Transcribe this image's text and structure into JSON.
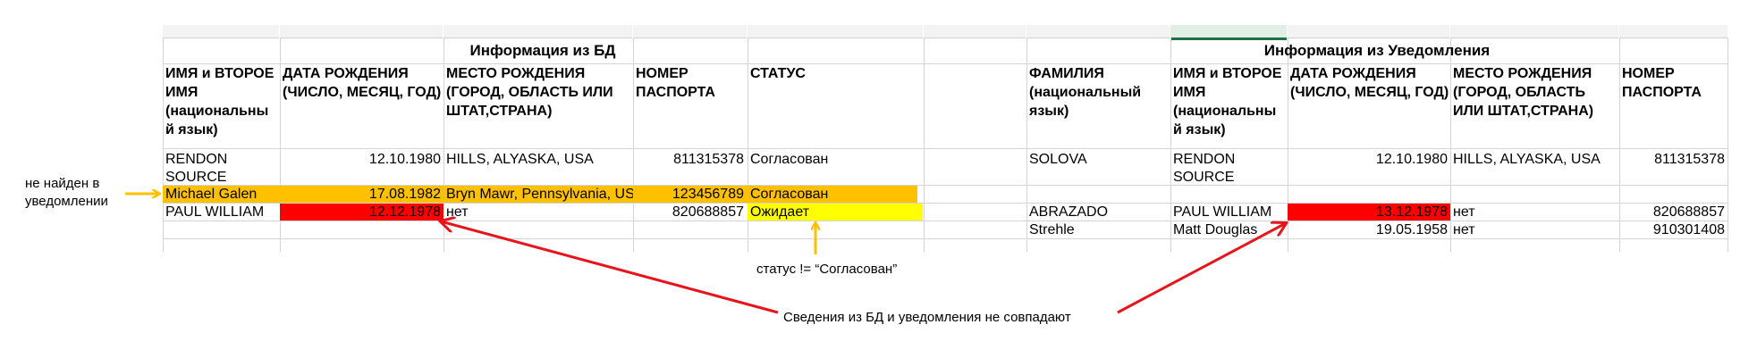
{
  "left_table": {
    "title": "Информация из БД",
    "headers": {
      "name": "ИМЯ и ВТОРОЕ ИМЯ (национальны й язык)",
      "dob": "ДАТА РОЖДЕНИЯ (ЧИСЛО, МЕСЯЦ, ГОД)",
      "pob": "МЕСТО РОЖДЕНИЯ (ГОРОД, ОБЛАСТЬ ИЛИ ШТАТ,СТРАНА)",
      "passport": "НОМЕР ПАСПОРТА",
      "status": "СТАТУС"
    },
    "rows": [
      {
        "name": "RENDON SOURCE",
        "dob": "12.10.1980",
        "pob": "HILLS, ALYASKA, USA",
        "passport": "811315378",
        "status": "Согласован"
      },
      {
        "name": "Michael Galen",
        "dob": "17.08.1982",
        "pob": "Bryn Mawr, Pennsylvania, US",
        "passport": "123456789",
        "status": "Согласован"
      },
      {
        "name": "PAUL WILLIAM",
        "dob": "12.12.1978",
        "pob": "нет",
        "passport": "820688857",
        "status": "Ожидает"
      }
    ]
  },
  "right_table": {
    "title": "Информация из Уведомления",
    "headers": {
      "surname": "ФАМИЛИЯ (национальный язык)",
      "name": "ИМЯ и ВТОРОЕ ИМЯ (национальны й язык)",
      "dob": "ДАТА РОЖДЕНИЯ (ЧИСЛО, МЕСЯЦ, ГОД)",
      "pob": "МЕСТО РОЖДЕНИЯ (ГОРОД, ОБЛАСТЬ ИЛИ ШТАТ,СТРАНА)",
      "passport": "НОМЕР ПАСПОРТА"
    },
    "rows": [
      {
        "surname": "SOLOVA",
        "name": "RENDON SOURCE",
        "dob": "12.10.1980",
        "pob": "HILLS, ALYASKA, USA",
        "passport": "811315378"
      },
      {
        "surname": "ABRAZADO",
        "name": "PAUL WILLIAM",
        "dob": "13.12.1978",
        "pob": "нет",
        "passport": "820688857"
      },
      {
        "surname": "Strehle",
        "name": "Matt Douglas",
        "dob": "19.05.1958",
        "pob": "нет",
        "passport": "910301408"
      }
    ]
  },
  "annotations": {
    "not_found": "не найден в уведомлении",
    "status_note": "статус != “Согласован”",
    "mismatch_note": "Сведения из БД и уведомления не совпадают"
  },
  "colors": {
    "orange_highlight": "#ffc000",
    "red_highlight": "#ff0000",
    "yellow_highlight": "#ffff00",
    "arrow_red": "#e8141b",
    "arrow_yellow": "#ffc000",
    "selected_column": "#1e7145"
  }
}
